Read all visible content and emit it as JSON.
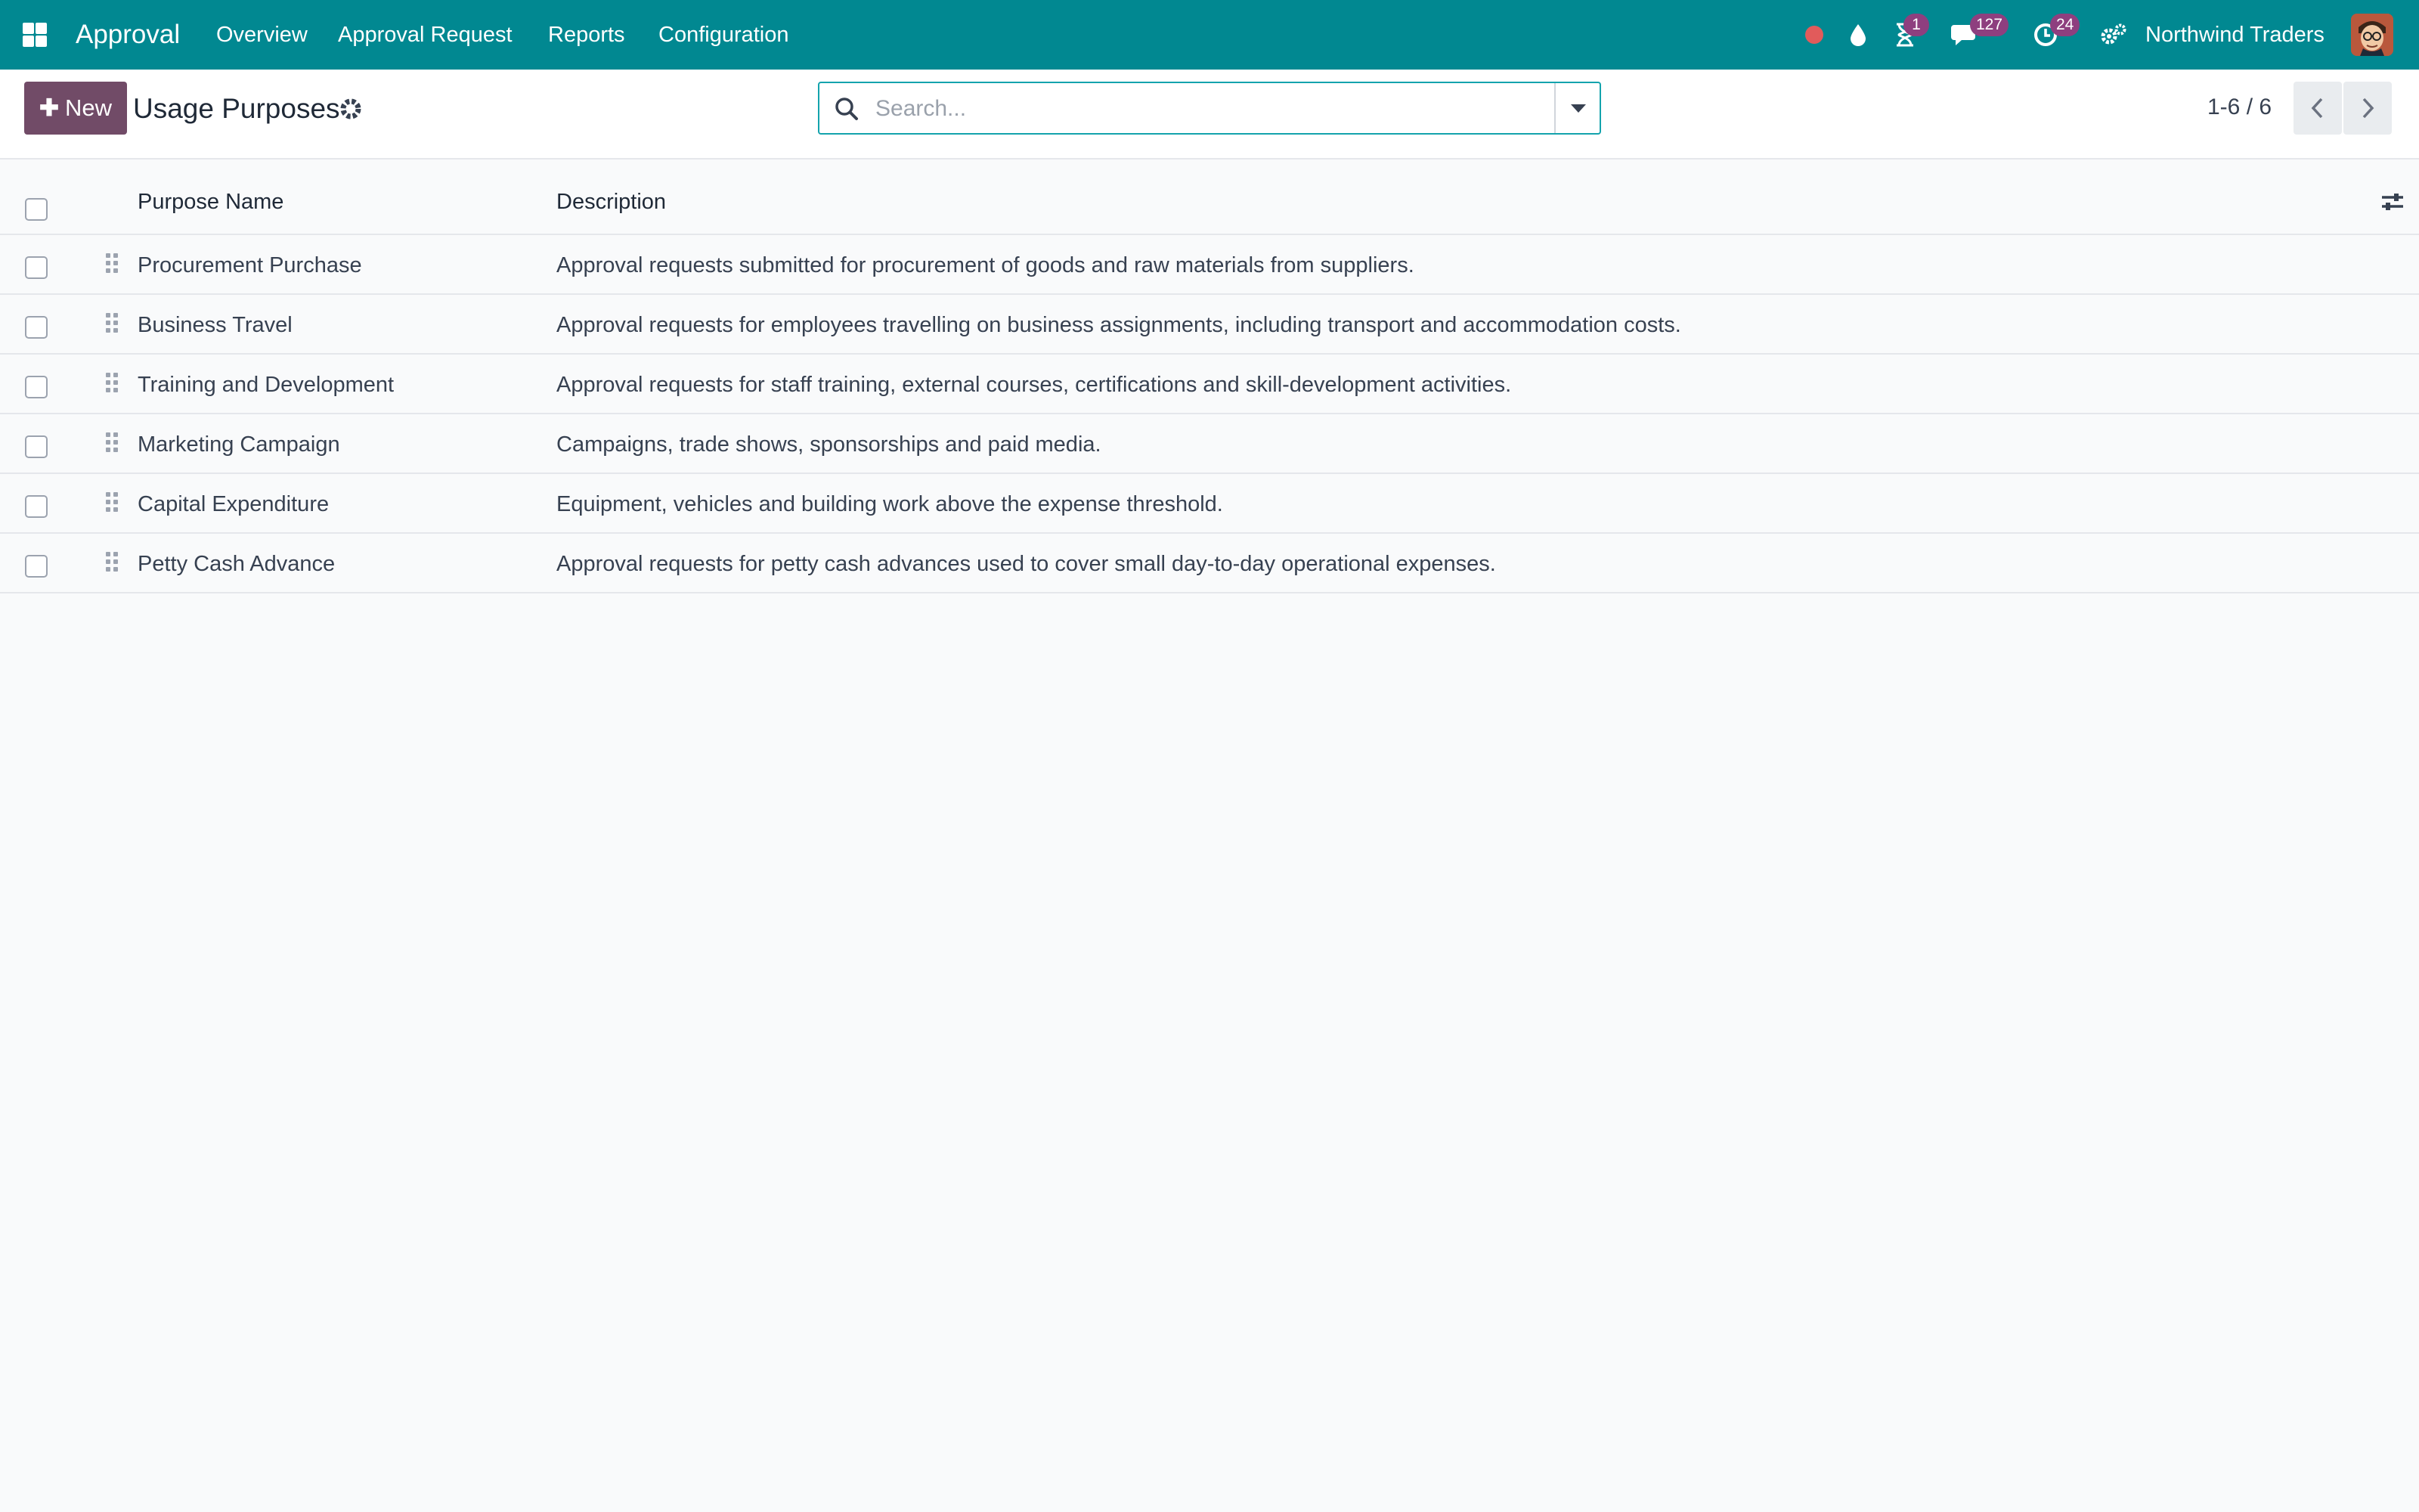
{
  "navbar": {
    "app_title": "Approval",
    "menu": [
      "Overview",
      "Approval Request",
      "Reports",
      "Configuration"
    ],
    "activity_badge": "1",
    "messages_badge": "127",
    "clock_badge": "24",
    "company": "Northwind Traders",
    "brand_color": "#018891",
    "status_dot_color": "#e15b5b"
  },
  "control_panel": {
    "new_label": "New",
    "title": "Usage Purposes",
    "search_placeholder": "Search...",
    "pager_value": "1-6 / 6",
    "button_color": "#714b67"
  },
  "table": {
    "columns": [
      "Purpose Name",
      "Description"
    ],
    "rows": [
      {
        "name": "Procurement Purchase",
        "description": "Approval requests submitted for procurement of goods and raw materials from suppliers."
      },
      {
        "name": "Business Travel",
        "description": "Approval requests for employees travelling on business assignments, including transport and accommodation costs."
      },
      {
        "name": "Training and Development",
        "description": "Approval requests for staff training, external courses, certifications and skill-development activities."
      },
      {
        "name": "Marketing Campaign",
        "description": "Campaigns, trade shows, sponsorships and paid media."
      },
      {
        "name": "Capital Expenditure",
        "description": "Equipment, vehicles and building work above the expense threshold."
      },
      {
        "name": "Petty Cash Advance",
        "description": "Approval requests for petty cash advances used to cover small day-to-day operational expenses."
      }
    ]
  }
}
